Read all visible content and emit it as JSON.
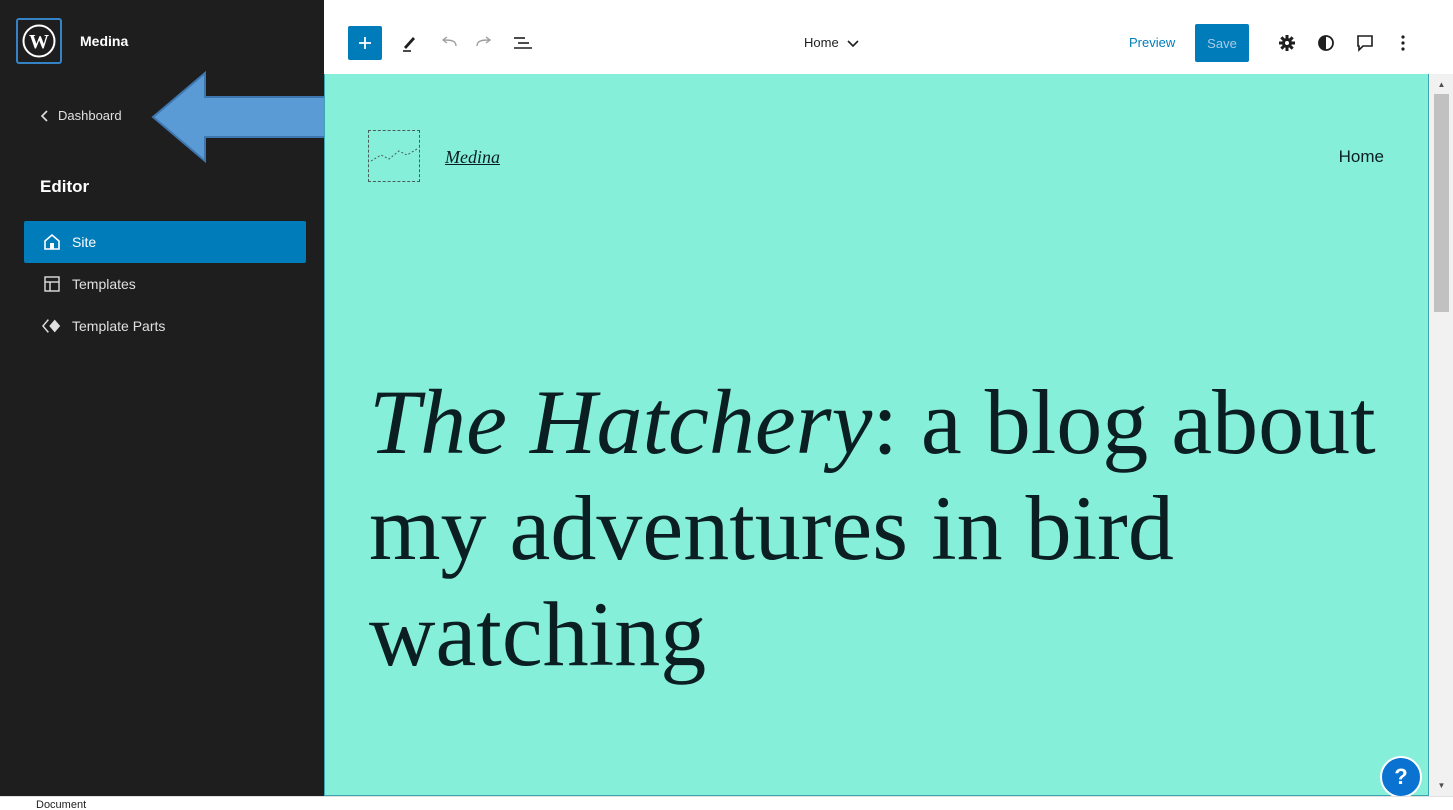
{
  "sidebar": {
    "site_title": "Medina",
    "back_label": "Dashboard",
    "heading": "Editor",
    "items": [
      {
        "label": "Site",
        "icon": "home-icon",
        "active": true
      },
      {
        "label": "Templates",
        "icon": "layout-icon",
        "active": false
      },
      {
        "label": "Template Parts",
        "icon": "symbol-filled-icon",
        "active": false
      }
    ]
  },
  "toolbar": {
    "inserter_icon": "plus-icon",
    "tools_icon": "pencil-icon",
    "undo_icon": "undo-icon",
    "redo_icon": "redo-icon",
    "list_view_icon": "list-view-icon",
    "document_title": "Home",
    "preview_label": "Preview",
    "save_label": "Save",
    "settings_icon": "gear-icon",
    "styles_icon": "contrast-icon",
    "comment_icon": "comment-icon",
    "options_icon": "more-vertical-icon"
  },
  "canvas": {
    "site_title": "Medina",
    "nav_item": "Home",
    "hero_italic": "The Hatchery",
    "hero_rest": ": a blog about my adventures in bird watching",
    "background": "#86efda"
  },
  "help_label": "?",
  "footer": {
    "breadcrumb": "Document"
  },
  "colors": {
    "accent": "#007cba",
    "sidebar_bg": "#1e1e1e",
    "annotation_arrow": "#5b9bd5"
  }
}
